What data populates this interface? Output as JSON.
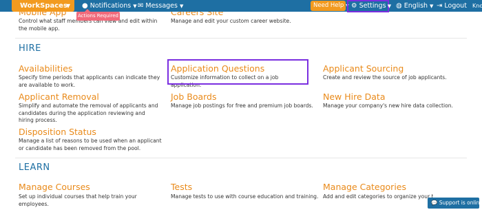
{
  "topbar": {
    "workspaces_label": "WorkSpaces",
    "notifications_label": "Notifications",
    "messages_label": "Messages",
    "need_help_label": "Need Help",
    "settings_label": "Settings",
    "language_label": "English",
    "logout_label": "Logout",
    "truncated_label": "Kno",
    "actions_tooltip": "Actions Required",
    "accent_color": "#1e6fa3",
    "orange_color": "#f29a1f"
  },
  "prev": {
    "mobile_app": {
      "title": "Mobile App",
      "desc": "Control what staff members can view and edit within the mobile app."
    },
    "careers_site": {
      "title": "Careers Site",
      "desc": "Manage and edit your custom career website."
    }
  },
  "hire": {
    "heading": "HIRE",
    "availabilities": {
      "title": "Availabilities",
      "desc": "Specify time periods that applicants can indicate they are available to work."
    },
    "application_questions": {
      "title": "Application Questions",
      "desc": "Customize information to collect on a job application."
    },
    "applicant_sourcing": {
      "title": "Applicant Sourcing",
      "desc": "Create and review the source of job applicants."
    },
    "applicant_removal": {
      "title": "Applicant Removal",
      "desc": "Simplify and automate the removal of applicants and candidates during the application reviewing and hiring process."
    },
    "job_boards": {
      "title": "Job Boards",
      "desc": "Manage job postings for free and premium job boards."
    },
    "new_hire_data": {
      "title": "New Hire Data",
      "desc": "Manage your company's new hire data collection."
    },
    "disposition_status": {
      "title": "Disposition Status",
      "desc": "Manage a list of reasons to be used when an applicant or candidate has been removed from the pool."
    }
  },
  "learn": {
    "heading": "LEARN",
    "manage_courses": {
      "title": "Manage Courses",
      "desc": "Set up individual courses that help train your employees."
    },
    "tests": {
      "title": "Tests",
      "desc": "Manage tests to use with course education and training."
    },
    "manage_categories": {
      "title": "Manage Categories",
      "desc": "Add and edit categories to organize your t"
    }
  },
  "support": {
    "label": "Support is online"
  }
}
